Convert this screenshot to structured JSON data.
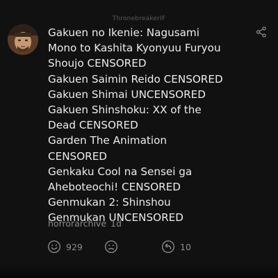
{
  "header": {
    "username": "ThronebreakerIF"
  },
  "comment": {
    "lines": [
      "Gakuen no Ikenie: Nagusami",
      "Mono to Kashita Kyonyuu Furyou",
      "Shoujo CENSORED",
      "Gakuen Saimin Reido CENSORED",
      "Gakuen Shimai UNCENSORED",
      "Gakuen Shinshoku: XX of the",
      "Dead CENSORED",
      "Garden The Animation",
      "CENSORED",
      "Genkaku Cool na Sensei ga",
      "Aheboteochi! CENSORED",
      "Genmukan 2: Shinshou",
      "Genmukan UNCENSORED"
    ],
    "author": "horrorarchive",
    "age": "1d"
  },
  "actions": {
    "like_count": "929",
    "reply_count": "10"
  },
  "icons": {
    "share": "share-icon",
    "like": "smile-icon",
    "dislike": "neutral-face-icon",
    "reply": "reply-icon"
  },
  "colors": {
    "background": "#111111",
    "text": "#ececec",
    "muted": "#8c8c8c"
  }
}
